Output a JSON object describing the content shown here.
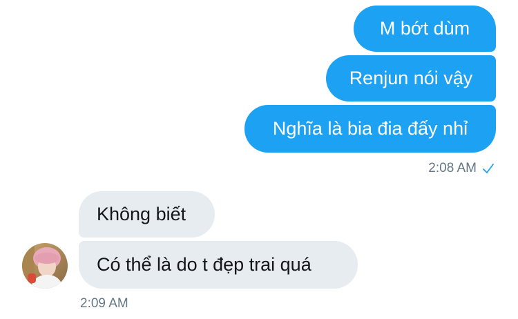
{
  "conversation": {
    "sent_messages": [
      {
        "text": "M bớt dùm"
      },
      {
        "text": "Renjun nói vậy"
      },
      {
        "text": "Nghĩa là bia đia đấy nhỉ"
      }
    ],
    "sent_time": "2:08 AM",
    "sent_status_icon": "check-icon",
    "received_messages": [
      {
        "text": "Không biết"
      },
      {
        "text": "Có thể là do t đẹp trai quá"
      }
    ],
    "received_time": "2:09 AM",
    "contact_avatar_icon": "avatar"
  },
  "colors": {
    "sent_bubble": "#1da1f2",
    "received_bubble": "#e6ecf0",
    "timestamp": "#657786",
    "check": "#1da1f2"
  }
}
